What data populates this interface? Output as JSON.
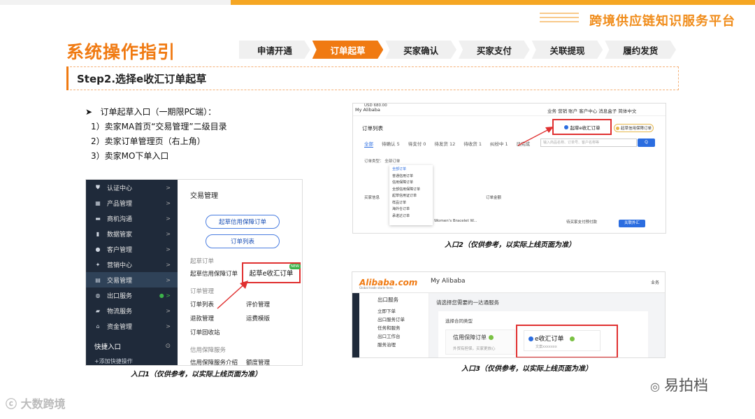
{
  "header": {
    "platform_name": "跨境供应链知识服务平台",
    "section_title": "系统操作指引",
    "steps": [
      {
        "label": "申请开通",
        "active": false
      },
      {
        "label": "订单起草",
        "active": true
      },
      {
        "label": "买家确认",
        "active": false
      },
      {
        "label": "买家支付",
        "active": false
      },
      {
        "label": "关联提现",
        "active": false
      },
      {
        "label": "履约发货",
        "active": false
      }
    ],
    "step_title": "Step2.选择e收汇订单起草"
  },
  "intro": {
    "lead": "订单起草入口（一期限PC端）：",
    "items": [
      "1）卖家MA首页“交易管理”二级目录",
      "2）卖家订单管理页（右上角）",
      "3）卖家MO下单入口"
    ]
  },
  "shot1": {
    "sidebar": [
      {
        "label": "认证中心",
        "icon": "shield-icon"
      },
      {
        "label": "产品管理",
        "icon": "grid-icon"
      },
      {
        "label": "商机沟通",
        "icon": "chat-icon"
      },
      {
        "label": "数据管家",
        "icon": "bar-chart-icon"
      },
      {
        "label": "客户管理",
        "icon": "users-icon"
      },
      {
        "label": "营销中心",
        "icon": "megaphone-icon"
      },
      {
        "label": "交易管理",
        "icon": "document-icon"
      },
      {
        "label": "出口服务",
        "icon": "globe-icon"
      },
      {
        "label": "物流服务",
        "icon": "truck-icon"
      },
      {
        "label": "资金管理",
        "icon": "bank-icon"
      }
    ],
    "quick_title": "快捷入口",
    "quick_add": "+添加快捷操作",
    "main_title": "交易管理",
    "btn_credit": "起草信用保障订单",
    "btn_list": "订单列表",
    "sec_draft": "起草订单",
    "link_credit": "起草信用保障订单",
    "link_ereceive": "起草e收汇订单",
    "new_badge": "NEW",
    "sec_manage": "订单管理",
    "link_list": "订单列表",
    "link_review": "评价管理",
    "link_refund": "退款管理",
    "link_template": "运费模版",
    "link_recycle": "订单回收站",
    "sec_service": "信用保障服务",
    "link_intro": "信用保障服务介绍",
    "link_quota": "额度管理",
    "caption": "入口1（仅供参考，以实际上线页面为准）"
  },
  "shot2": {
    "brand": "My Alibaba",
    "top_right": "业务  营销  账户    客户中心    消息盒子    简体中文",
    "title": "订单列表",
    "tabs": [
      "全部",
      "待确认 5",
      "待支付 0",
      "待发货 12",
      "待收货 1",
      "纠纷中 1",
      "已完成"
    ],
    "draft_btn": "起草e收汇订单",
    "credit_btn": "起草信用保障订单",
    "search_placeholder": "输入商品名称、订单号、客户名称等",
    "search_btn": "Q",
    "filter": "订单类型：  全部订单",
    "dropdown": [
      "全部订单",
      "普通信用订单",
      "信用保障订单",
      "全部信用保障订单",
      "起草信用证订单",
      "样品订单",
      "海外仓订单",
      "承诺达订单"
    ],
    "row1": "买家信息",
    "row2": "订单金额",
    "amount": "USD 680.00",
    "product": "Women's Bracelet W...",
    "status": "待买家支付预付款",
    "action_btn": "关联外汇",
    "caption": "入口2（仅供参考，以实际上线页面为准）"
  },
  "shot3": {
    "logo": "Alibaba.com",
    "logo_sub": "Global trade starts here.",
    "brand": "My Alibaba",
    "top_right": "业务",
    "nav_head": "出口服务",
    "nav": [
      "立即下单",
      "出口服务订单",
      "",
      "任务和服务",
      "出口工作台",
      "服务治理"
    ],
    "question": "请选择您需要的一达通服务",
    "contract_label": "选择合同类型",
    "opt_credit": "信用保障订单",
    "opt_credit_sub": "外贸有担保，买家更放心",
    "opt_e": "e收汇订单",
    "opt_e_sub": "文案xxxxxxx",
    "caption": "入口3（仅供参考，以实际上线页面为准）",
    "colors": {
      "credit_dot": "#7ac143",
      "e_dot": "#2b6de0",
      "e_check": "#7ac143"
    }
  },
  "watermark": {
    "left": "大数跨境",
    "right": "易拍档"
  },
  "colors": {
    "accent": "#f07a12",
    "highlight": "#e03030",
    "link_blue": "#2b6de0"
  }
}
